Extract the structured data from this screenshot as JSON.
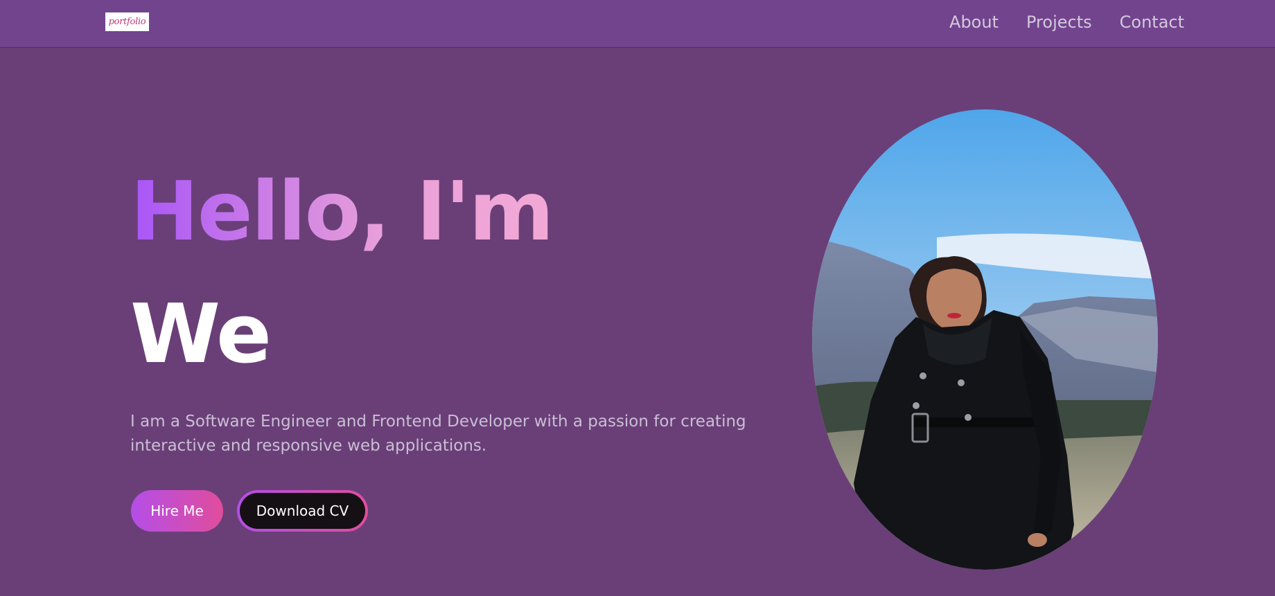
{
  "header": {
    "logo_text": "portfolio",
    "nav": [
      {
        "label": "About"
      },
      {
        "label": "Projects"
      },
      {
        "label": "Contact"
      }
    ]
  },
  "hero": {
    "greeting": "Hello, I'm",
    "name": "We",
    "description": "I am a Software Engineer and Frontend Developer with a passion for creating interactive and responsive web applications.",
    "hire_button": "Hire Me",
    "cv_button": "Download CV"
  },
  "colors": {
    "background": "#6a3f78",
    "navbar": "#72448e",
    "accent_start": "#a855f7",
    "accent_end": "#e04d9c"
  }
}
